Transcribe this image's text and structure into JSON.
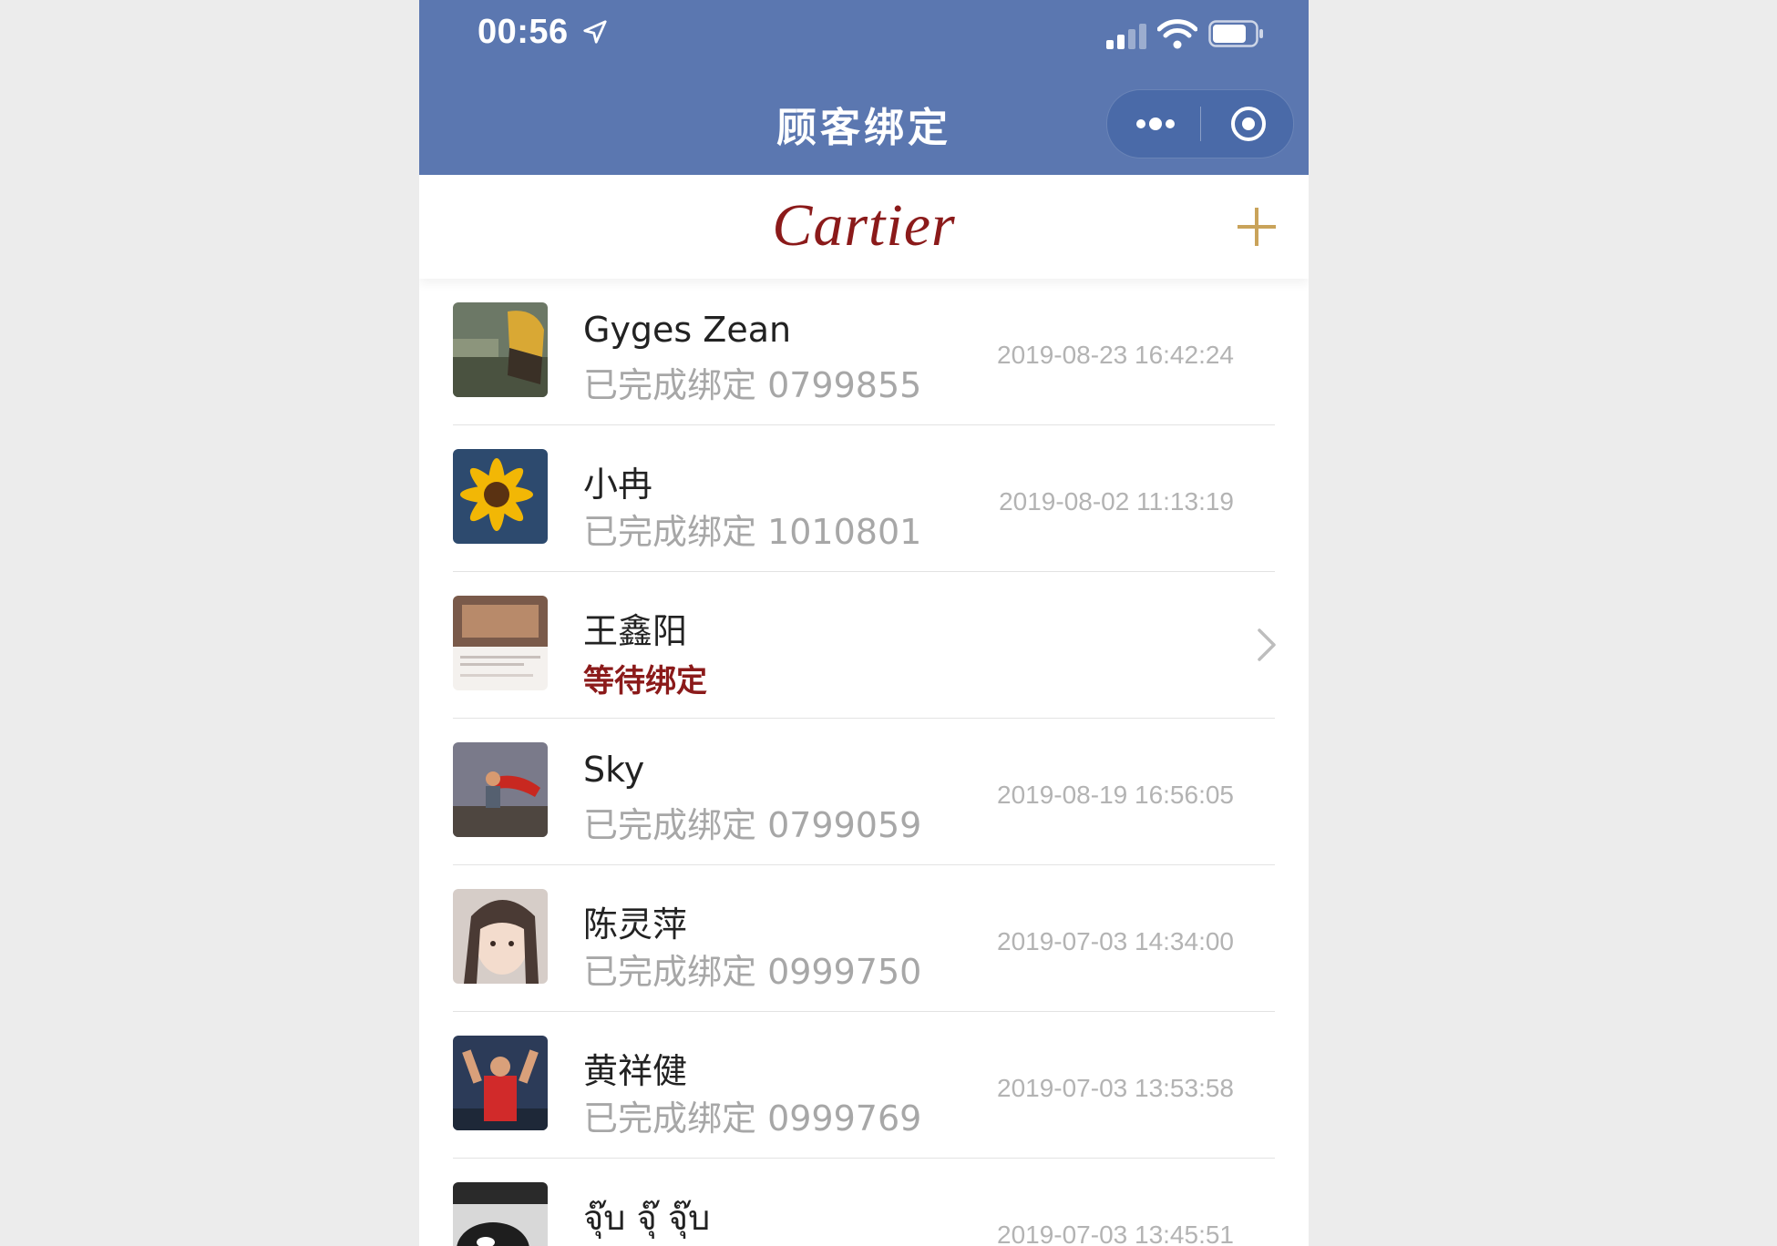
{
  "status_bar": {
    "time": "00:56"
  },
  "nav": {
    "title": "顾客绑定"
  },
  "brand": {
    "logo_text": "Cartier",
    "accent": "#8b1a1a"
  },
  "colors": {
    "nav_bg": "#5b77b0",
    "plus": "#c9a35a",
    "muted": "#a7a7a7"
  },
  "customers": [
    {
      "name": "Gyges Zean",
      "status": "已完成绑定 0799855",
      "time": "2019-08-23 16:42:24",
      "pending": false
    },
    {
      "name": "小冉",
      "status": "已完成绑定 1010801",
      "time": "2019-08-02 11:13:19",
      "pending": false
    },
    {
      "name": "王鑫阳",
      "status": "等待绑定",
      "time": "",
      "pending": true
    },
    {
      "name": "Sky",
      "status": "已完成绑定 0799059",
      "time": "2019-08-19 16:56:05",
      "pending": false
    },
    {
      "name": "陈灵萍",
      "status": "已完成绑定 0999750",
      "time": "2019-07-03 14:34:00",
      "pending": false
    },
    {
      "name": "黄祥健",
      "status": "已完成绑定 0999769",
      "time": "2019-07-03 13:53:58",
      "pending": false
    },
    {
      "name": "จุ๊บ จุ๊ จุ๊บ",
      "status": "",
      "time": "2019-07-03 13:45:51",
      "pending": false
    }
  ]
}
